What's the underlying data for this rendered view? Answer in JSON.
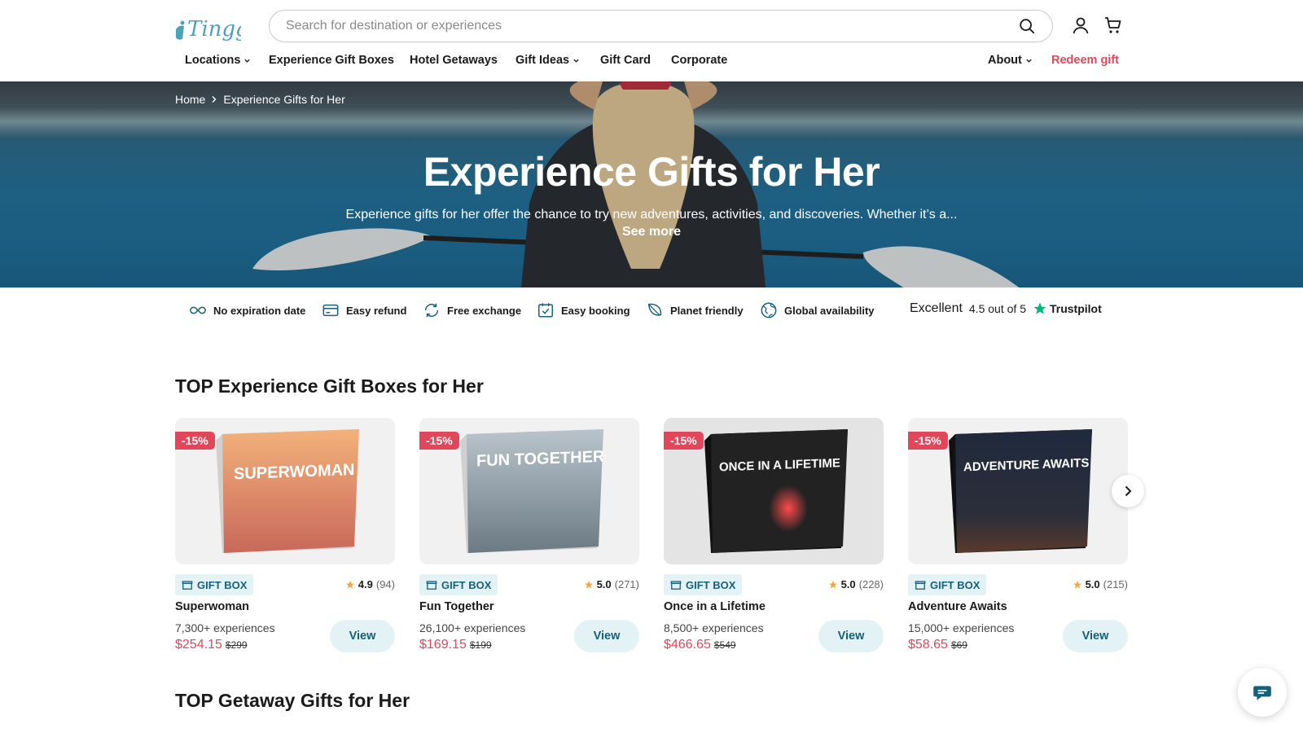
{
  "header": {
    "logo_text": "Tinggly",
    "search_placeholder": "Search for destination or experiences"
  },
  "nav": {
    "left": [
      {
        "label": "Locations",
        "dropdown": true
      },
      {
        "label": "Experience Gift Boxes",
        "dropdown": false
      },
      {
        "label": "Hotel Getaways",
        "dropdown": false
      },
      {
        "label": "Gift Ideas",
        "dropdown": true
      },
      {
        "label": "Gift Card",
        "dropdown": false
      },
      {
        "label": "Corporate",
        "dropdown": false
      }
    ],
    "about": "About",
    "redeem": "Redeem gift"
  },
  "breadcrumb": {
    "home": "Home",
    "current": "Experience Gifts for Her"
  },
  "hero": {
    "title": "Experience Gifts for Her",
    "description": "Experience gifts for her offer the chance to try new adventures, activities, and discoveries. Whether it’s a...",
    "see_more": "See more"
  },
  "usps": [
    {
      "icon": "infinity-icon",
      "label": "No expiration date"
    },
    {
      "icon": "card-icon",
      "label": "Easy refund"
    },
    {
      "icon": "exchange-icon",
      "label": "Free exchange"
    },
    {
      "icon": "calendar-check-icon",
      "label": "Easy booking"
    },
    {
      "icon": "leaf-icon",
      "label": "Planet friendly"
    },
    {
      "icon": "globe-icon",
      "label": "Global availability"
    }
  ],
  "trustpilot": {
    "rating_word": "Excellent",
    "score": "4.5 out of 5",
    "brand": "Trustpilot"
  },
  "sections": {
    "top_boxes": "TOP Experience Gift Boxes for Her",
    "top_getaways": "TOP Getaway Gifts for Her"
  },
  "cards": [
    {
      "discount": "-15%",
      "box_title": "SUPERWOMAN",
      "badge": "GIFT BOX",
      "rating": "4.9",
      "count": "(94)",
      "name": "Superwoman",
      "experiences": "7,300+ experiences",
      "price": "$254.15",
      "old_price": "$299",
      "view": "View",
      "color_top": "#f2b27a",
      "color_bottom": "#c9685a"
    },
    {
      "discount": "-15%",
      "box_title": "FUN TOGETHER",
      "badge": "GIFT BOX",
      "rating": "5.0",
      "count": "(271)",
      "name": "Fun Together",
      "experiences": "26,100+ experiences",
      "price": "$169.15",
      "old_price": "$199",
      "view": "View",
      "color_top": "#b9c4cc",
      "color_bottom": "#6c7a84"
    },
    {
      "discount": "-15%",
      "box_title": "ONCE IN A LIFETIME",
      "badge": "GIFT BOX",
      "rating": "5.0",
      "count": "(228)",
      "name": "Once in a Lifetime",
      "experiences": "8,500+ experiences",
      "price": "$466.65",
      "old_price": "$549",
      "view": "View",
      "color_top": "#2b2b2b",
      "color_bottom": "#1a1a1a"
    },
    {
      "discount": "-15%",
      "box_title": "ADVENTURE AWAITS",
      "badge": "GIFT BOX",
      "rating": "5.0",
      "count": "(215)",
      "name": "Adventure Awaits",
      "experiences": "15,000+ experiences",
      "price": "$58.65",
      "old_price": "$69",
      "view": "View",
      "color_top": "#1f2a3c",
      "color_bottom": "#3a2a26"
    }
  ],
  "colors": {
    "accent_red": "#e1475b",
    "teal": "#17607a",
    "teal_light": "#e3f2f5",
    "star": "#f4a73b",
    "trustpilot_green": "#00b67a"
  }
}
